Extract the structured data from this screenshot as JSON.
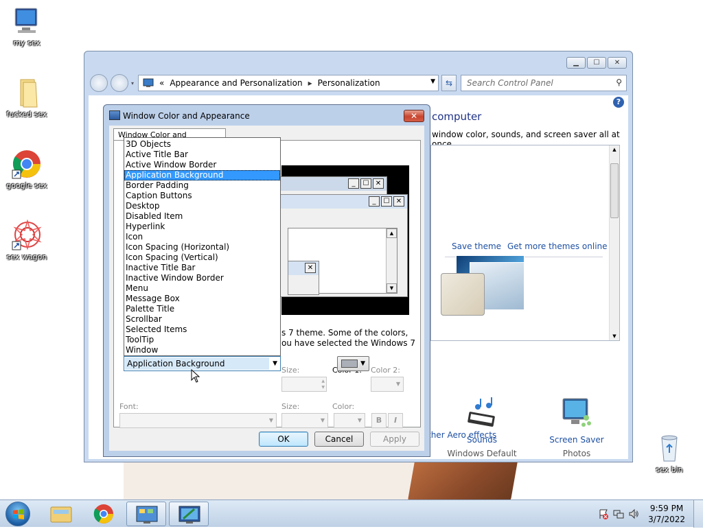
{
  "desktop": {
    "icons": [
      {
        "label": "my sex"
      },
      {
        "label": "fucked sex"
      },
      {
        "label": "google sex"
      },
      {
        "label": "sex wagon"
      },
      {
        "label": "sex bin"
      }
    ]
  },
  "control_panel": {
    "address": {
      "prefix": "«",
      "crumb1": "Appearance and Personalization",
      "crumb2": "Personalization"
    },
    "search_placeholder": "Search Control Panel",
    "heading": "computer",
    "subtitle": "window color, sounds, and screen saver all at once.",
    "save_theme": "Save theme",
    "get_more_themes": "Get more themes online",
    "sounds_title": "Sounds",
    "sounds_sub": "Windows Default",
    "screensaver_title": "Screen Saver",
    "screensaver_sub": "Photos",
    "aero_link": "ther Aero effects"
  },
  "dialog": {
    "title": "Window Color and Appearance",
    "tab": "Window Color and Appearance",
    "description_line1": "s 7 theme.  Some of the colors,",
    "description_line2": "ou have selected the Windows 7",
    "size_label": "Size:",
    "color1_label": "Color 1:",
    "color2_label": "Color 2:",
    "font_label": "Font:",
    "font_size_label": "Size:",
    "font_color_label": "Color:",
    "bold": "B",
    "italic": "I",
    "item_selected": "Application Background",
    "ok": "OK",
    "cancel": "Cancel",
    "apply": "Apply",
    "color1_swatch": "#abb0b8"
  },
  "item_list": {
    "options": [
      "3D Objects",
      "Active Title Bar",
      "Active Window Border",
      "Application Background",
      "Border Padding",
      "Caption Buttons",
      "Desktop",
      "Disabled Item",
      "Hyperlink",
      "Icon",
      "Icon Spacing (Horizontal)",
      "Icon Spacing (Vertical)",
      "Inactive Title Bar",
      "Inactive Window Border",
      "Menu",
      "Message Box",
      "Palette Title",
      "Scrollbar",
      "Selected Items",
      "ToolTip",
      "Window"
    ],
    "selected_index": 3
  },
  "taskbar": {
    "time": "9:59 PM",
    "date": "3/7/2022"
  }
}
